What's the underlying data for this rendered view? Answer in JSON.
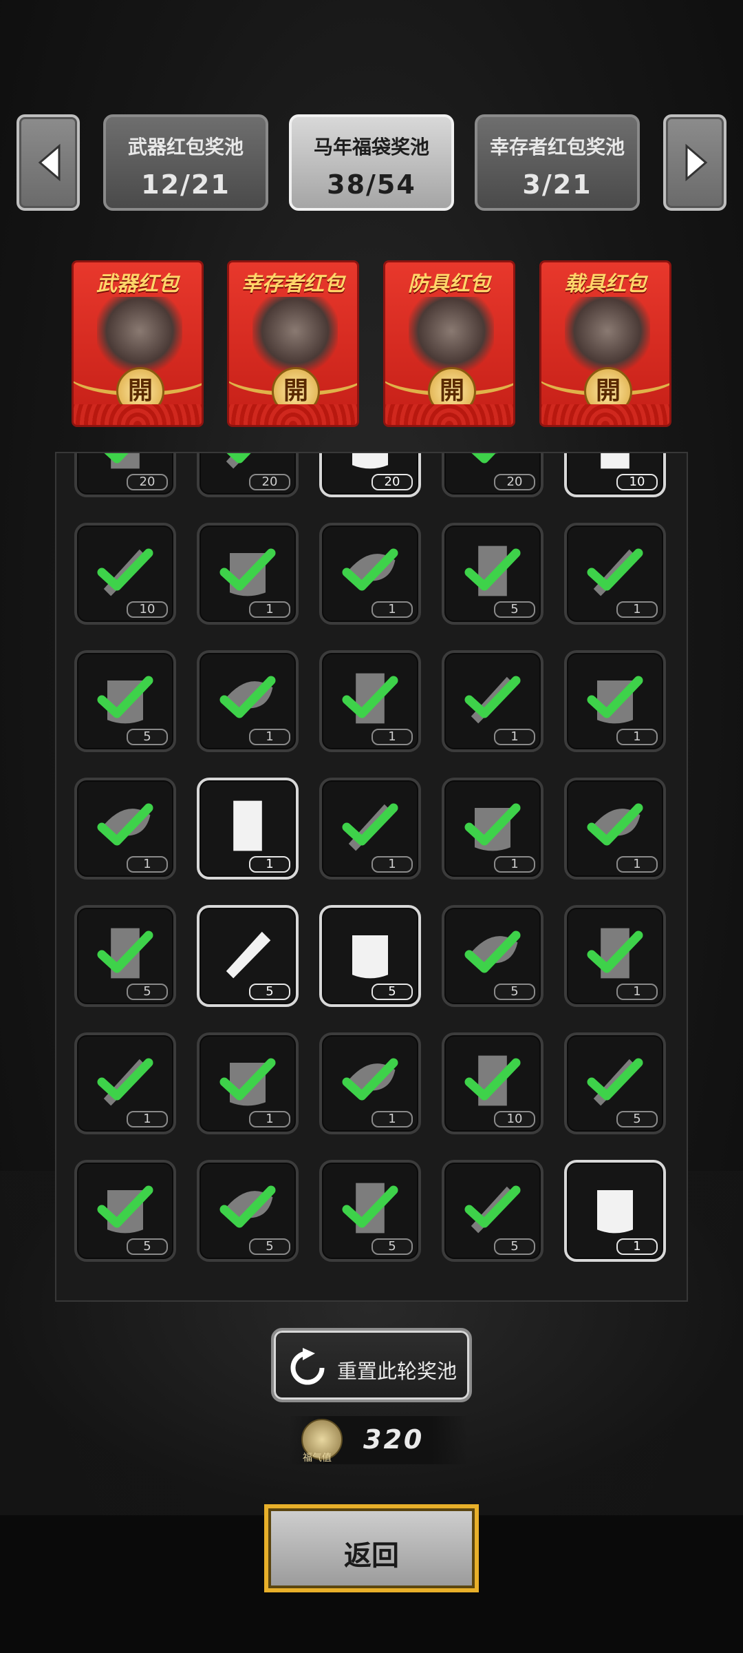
{
  "pool_tabs": [
    {
      "name": "武器红包奖池",
      "count": "12/21",
      "active": false
    },
    {
      "name": "马年福袋奖池",
      "count": "38/54",
      "active": true
    },
    {
      "name": "幸存者红包奖池",
      "count": "3/21",
      "active": false
    }
  ],
  "nav": {
    "prev_icon": "arrow-left-icon",
    "next_icon": "arrow-right-icon"
  },
  "red_packets": [
    {
      "title": "武器红包",
      "seal": "開",
      "art": "weapon-rider-art"
    },
    {
      "title": "幸存者红包",
      "seal": "開",
      "art": "survivor-helmet-art"
    },
    {
      "title": "防具红包",
      "seal": "開",
      "art": "armored-soldier-art"
    },
    {
      "title": "载具红包",
      "seal": "開",
      "art": "vehicle-mech-art"
    }
  ],
  "items": [
    {
      "icon": "battery-pack-icon",
      "qty": "20",
      "claimed": true
    },
    {
      "icon": "bullet-icon",
      "qty": "20",
      "claimed": true
    },
    {
      "icon": "fuel-barrel-icon",
      "qty": "20",
      "claimed": false
    },
    {
      "icon": "shell-casing-icon",
      "qty": "20",
      "claimed": true
    },
    {
      "icon": "syringe-icon",
      "qty": "10",
      "claimed": false
    },
    {
      "icon": "grenade-canister-icon",
      "qty": "10",
      "claimed": true
    },
    {
      "icon": "drink-cup-icon",
      "qty": "1",
      "claimed": true
    },
    {
      "icon": "jar-icon",
      "qty": "1",
      "claimed": true
    },
    {
      "icon": "net-trap-icon",
      "qty": "5",
      "claimed": true
    },
    {
      "icon": "juice-glass-icon",
      "qty": "1",
      "claimed": true
    },
    {
      "icon": "helmet-net-icon",
      "qty": "5",
      "claimed": true
    },
    {
      "icon": "thorn-branch-icon",
      "qty": "1",
      "claimed": true
    },
    {
      "icon": "cloth-stack-icon",
      "qty": "1",
      "claimed": true
    },
    {
      "icon": "sack-icon",
      "qty": "1",
      "claimed": true
    },
    {
      "icon": "medicine-bottle-icon",
      "qty": "1",
      "claimed": true
    },
    {
      "icon": "boot-icon",
      "qty": "1",
      "claimed": true
    },
    {
      "icon": "seeds-icon",
      "qty": "1",
      "claimed": false
    },
    {
      "icon": "tube-icon",
      "qty": "1",
      "claimed": true
    },
    {
      "icon": "ammo-clips-icon",
      "qty": "1",
      "claimed": true
    },
    {
      "icon": "boot-icon",
      "qty": "1",
      "claimed": true
    },
    {
      "icon": "poison-dart-icon",
      "qty": "5",
      "claimed": true
    },
    {
      "icon": "rocket-icon",
      "qty": "5",
      "claimed": false
    },
    {
      "icon": "flashbang-icon",
      "qty": "5",
      "claimed": false
    },
    {
      "icon": "frag-grenade-icon",
      "qty": "5",
      "claimed": true
    },
    {
      "icon": "dynamite-icon",
      "qty": "1",
      "claimed": true
    },
    {
      "icon": "hand-grenade-icon",
      "qty": "1",
      "claimed": true
    },
    {
      "icon": "lamp-icon",
      "qty": "1",
      "claimed": true
    },
    {
      "icon": "flare-gun-icon",
      "qty": "1",
      "claimed": true
    },
    {
      "icon": "metal-plate-icon",
      "qty": "10",
      "claimed": true
    },
    {
      "icon": "batteries-icon",
      "qty": "5",
      "claimed": true
    },
    {
      "icon": "spool-icon",
      "qty": "5",
      "claimed": true
    },
    {
      "icon": "turret-part-icon",
      "qty": "5",
      "claimed": true
    },
    {
      "icon": "blade-part-icon",
      "qty": "5",
      "claimed": true
    },
    {
      "icon": "bandage-roll-icon",
      "qty": "5",
      "claimed": true
    },
    {
      "icon": "blueprint-scroll-icon",
      "qty": "1",
      "claimed": false
    }
  ],
  "reset_label": "重置此轮奖池",
  "luck": {
    "label": "福气值",
    "value": "320"
  },
  "back_label": "返回",
  "colors": {
    "claimed_check": "#3ed24a",
    "packet_red": "#d8281e",
    "gold": "#e8b02a"
  }
}
